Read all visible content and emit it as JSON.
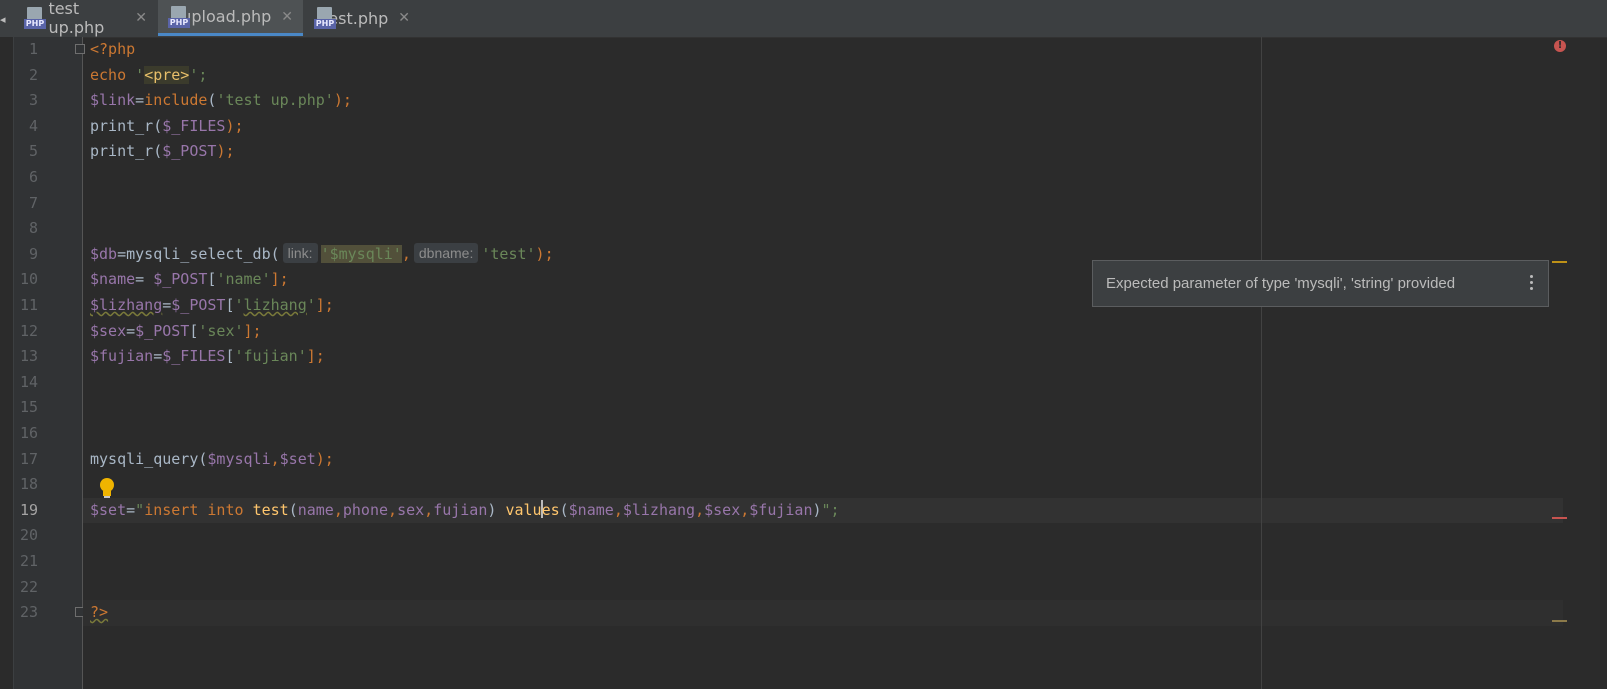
{
  "tabs": [
    {
      "label": "test up.php",
      "icon": "php-file-icon",
      "active": false
    },
    {
      "label": "upload.php",
      "icon": "php-file-icon",
      "active": true
    },
    {
      "label": "test.php",
      "icon": "php-file-icon",
      "active": false
    }
  ],
  "icons": {
    "php_badge": "PHP",
    "close": "✕",
    "scroll_left": "◂"
  },
  "editor": {
    "line_numbers": [
      "1",
      "2",
      "3",
      "4",
      "5",
      "6",
      "7",
      "8",
      "9",
      "10",
      "11",
      "12",
      "13",
      "14",
      "15",
      "16",
      "17",
      "18",
      "19",
      "20",
      "21",
      "22",
      "23"
    ],
    "current_line": 19,
    "tokens": {
      "l1_open": "<?php",
      "l2_echo": "echo",
      "l2_q1": "'",
      "l2_tag": "<pre>",
      "l2_q2": "';",
      "l3_var": "$link",
      "l3_eq": "=",
      "l3_fn": "include",
      "l3_po": "(",
      "l3_str": "'test up.php'",
      "l3_pc": ");",
      "l4_fn": "print_r(",
      "l4_var": "$_FILES",
      "l4_pc": ");",
      "l5_fn": "print_r(",
      "l5_var": "$_POST",
      "l5_pc": ");",
      "l9_var": "$db",
      "l9_eq": "=",
      "l9_fn": "mysqli_select_db(",
      "l9_hint1": "link:",
      "l9_str1": "'$mysqli'",
      "l9_comma": ",",
      "l9_hint2": "dbname:",
      "l9_str2": "'test'",
      "l9_pc": ");",
      "l10_var": "$name",
      "l10_eq": "= ",
      "l10_var2": "$_POST",
      "l10_bo": "[",
      "l10_str": "'name'",
      "l10_bc": "];",
      "l11_var": "$lizhang",
      "l11_eq": "=",
      "l11_var2": "$_POST",
      "l11_bo": "[",
      "l11_q1": "'",
      "l11_str": "lizhang",
      "l11_q2": "'",
      "l11_bc": "];",
      "l12_var": "$sex",
      "l12_eq": "=",
      "l12_var2": "$_POST",
      "l12_bo": "[",
      "l12_str": "'sex'",
      "l12_bc": "];",
      "l13_var": "$fujian",
      "l13_eq": "=",
      "l13_var2": "$_FILES",
      "l13_bo": "[",
      "l13_str": "'fujian'",
      "l13_bc": "];",
      "l17_fn": "mysqli_query(",
      "l17_var1": "$mysqli",
      "l17_comma": ",",
      "l17_var2": "$set",
      "l17_pc": ");",
      "l19_var": "$set",
      "l19_eq": "=",
      "l19_q1": "\"",
      "l19_insert": "insert",
      "l19_into": " into ",
      "l19_tbl": "test",
      "l19_po": "(",
      "l19_c1": "name",
      "l19_cm1": ",",
      "l19_c2": "phone",
      "l19_cm2": ",",
      "l19_c3": "sex",
      "l19_cm3": ",",
      "l19_c4": "fujian",
      "l19_pc": ") ",
      "l19_val_a": "valu",
      "l19_val_b": "es",
      "l19_vpo": "(",
      "l19_v1": "$name",
      "l19_vcm1": ",",
      "l19_v2": "$lizhang",
      "l19_vcm2": ",",
      "l19_v3": "$sex",
      "l19_vcm3": ",",
      "l19_v4": "$fujian",
      "l19_vpc": ")",
      "l19_q2": "\";",
      "l23_close": "?>"
    }
  },
  "tooltip": {
    "message": "Expected parameter of type 'mysqli', 'string' provided"
  },
  "status": {
    "error_badge": "!"
  },
  "colors": {
    "accent": "#4a88c7",
    "error": "#c75450",
    "warning": "#be9117"
  }
}
